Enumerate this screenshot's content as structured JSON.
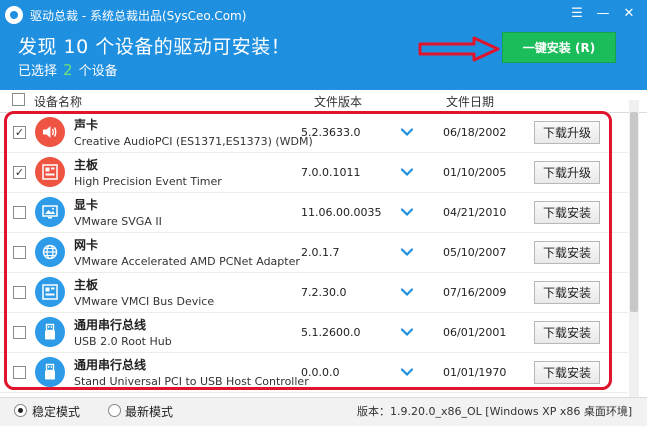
{
  "window": {
    "title": "驱动总裁 - 系统总裁出品(SysCeo.Com)"
  },
  "header": {
    "headline": "发现 10 个设备的驱动可安装！",
    "selected_prefix": "已选择",
    "selected_count": "2",
    "selected_suffix": "个设备",
    "install_button": "一键安装 (R)",
    "accent_color": "#1f8fe0",
    "install_color": "#1bbd5a"
  },
  "columns": {
    "name": "设备名称",
    "version": "文件版本",
    "date": "文件日期"
  },
  "devices": [
    {
      "title": "声卡",
      "model": "Creative AudioPCI (ES1371,ES1373) (WDM)",
      "version": "5.2.3633.0",
      "date": "06/18/2002",
      "action": "下载升级",
      "checked": true,
      "icon": "speaker-icon",
      "icon_color": "#ef5342"
    },
    {
      "title": "主板",
      "model": "High Precision Event Timer",
      "version": "7.0.0.1011",
      "date": "01/10/2005",
      "action": "下载升级",
      "checked": true,
      "icon": "motherboard-icon",
      "icon_color": "#ef5342"
    },
    {
      "title": "显卡",
      "model": "VMware SVGA II",
      "version": "11.06.00.0035",
      "date": "04/21/2010",
      "action": "下载安装",
      "checked": false,
      "icon": "display-icon",
      "icon_color": "#2d9be8"
    },
    {
      "title": "网卡",
      "model": "VMware Accelerated AMD PCNet Adapter",
      "version": "2.0.1.7",
      "date": "05/10/2007",
      "action": "下载安装",
      "checked": false,
      "icon": "globe-icon",
      "icon_color": "#2d9be8"
    },
    {
      "title": "主板",
      "model": "VMware VMCI Bus Device",
      "version": "7.2.30.0",
      "date": "07/16/2009",
      "action": "下载安装",
      "checked": false,
      "icon": "motherboard-icon",
      "icon_color": "#2d9be8"
    },
    {
      "title": "通用串行总线",
      "model": "USB 2.0 Root Hub",
      "version": "5.1.2600.0",
      "date": "06/01/2001",
      "action": "下载安装",
      "checked": false,
      "icon": "usb-icon",
      "icon_color": "#2d9be8"
    },
    {
      "title": "通用串行总线",
      "model": "Stand Universal PCI to USB Host Controller",
      "version": "0.0.0.0",
      "date": "01/01/1970",
      "action": "下载安装",
      "checked": false,
      "icon": "usb-icon",
      "icon_color": "#2d9be8"
    }
  ],
  "footer": {
    "mode_stable": "稳定模式",
    "mode_latest": "最新模式",
    "version_text": "版本：1.9.20.0_x86_OL [Windows XP x86 桌面环境]"
  }
}
